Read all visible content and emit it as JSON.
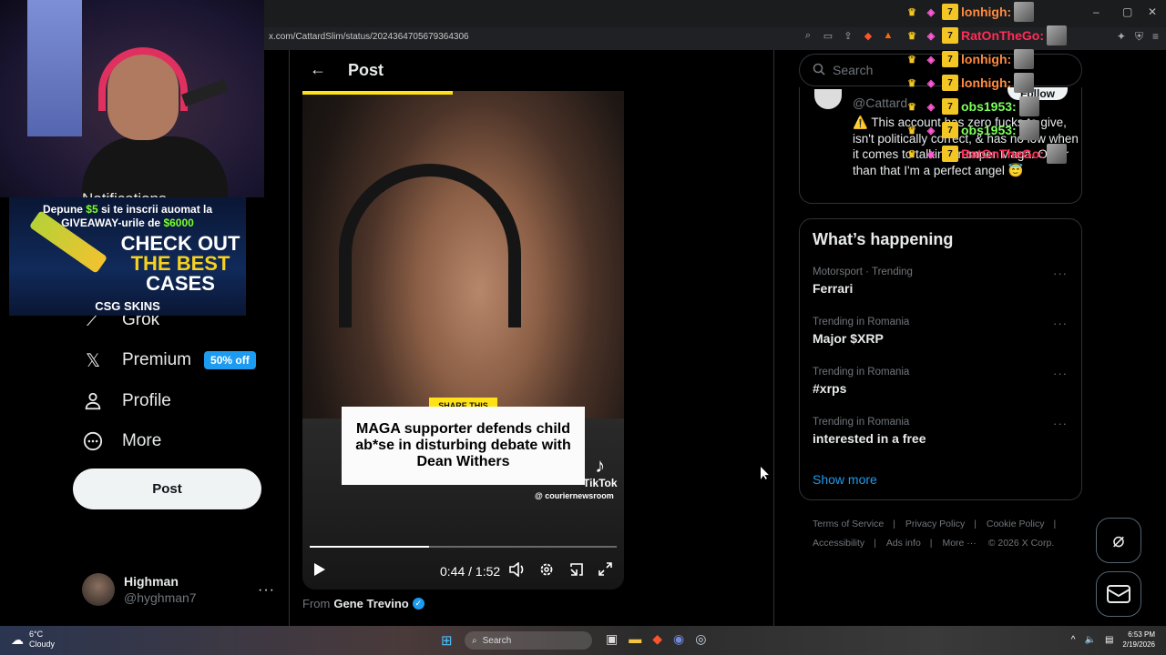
{
  "browser": {
    "url": "x.com/CattardSlim/status/2024364705679364306",
    "window_controls": [
      "–",
      "▢",
      "✕"
    ]
  },
  "nav": {
    "hidden_item": "Notifications",
    "items": [
      {
        "label": "Grok",
        "icon": "grok-icon"
      },
      {
        "label": "Premium",
        "icon": "x-logo-icon",
        "badge": "50% off"
      },
      {
        "label": "Profile",
        "icon": "profile-icon"
      },
      {
        "label": "More",
        "icon": "more-circle-icon"
      }
    ],
    "post_button": "Post",
    "account": {
      "name": "Highman",
      "handle": "@hyghman7",
      "more": "···"
    }
  },
  "header": {
    "back": "←",
    "title": "Post"
  },
  "video": {
    "share_tag": "SHARE THIS",
    "caption": "MAGA supporter defends child ab*se in disturbing debate with  Dean Withers",
    "tiktok": "TikTok",
    "watermark": "@ couriernewsroom",
    "time": "0:44 / 1:52",
    "progress": 0.39
  },
  "from": {
    "label": "From",
    "name": "Gene Trevino"
  },
  "search": {
    "placeholder": "Search"
  },
  "profile_card": {
    "handle": "@Cattard",
    "follow": "Follow",
    "bio": "⚠️ This account has zero fucks to give, isn't politically correct, & has no low when it comes to talking trumper Maga. Other than that I'm a perfect angel 😇"
  },
  "trends": {
    "title": "What’s happening",
    "items": [
      {
        "meta": "Motorsport · Trending",
        "name": "Ferrari"
      },
      {
        "meta": "Trending in Romania",
        "name": "Major $XRP"
      },
      {
        "meta": "Trending in Romania",
        "name": "#xrps"
      },
      {
        "meta": "Trending in Romania",
        "name": "interested in a free"
      }
    ],
    "more_glyph": "···",
    "show_more": "Show more"
  },
  "footer": {
    "links": [
      "Terms of Service",
      "Privacy Policy",
      "Cookie Policy",
      "Accessibility",
      "Ads info",
      "More ···",
      "© 2026 X Corp."
    ]
  },
  "chat": [
    {
      "user": "lonhigh:",
      "color": "#ff8a3d"
    },
    {
      "user": "RatOnTheGo:",
      "color": "#ff2d55"
    },
    {
      "user": "lonhigh:",
      "color": "#ff8a3d"
    },
    {
      "user": "lonhigh:",
      "color": "#ff8a3d"
    },
    {
      "user": "obs1953:",
      "color": "#7cff5a"
    },
    {
      "user": "obs1953:",
      "color": "#7cff5a"
    },
    {
      "user": "RatOnTheGo:",
      "color": "#ff2d55"
    }
  ],
  "ad": {
    "line1_a": "Depune",
    "line1_amount": "$5",
    "line1_b": "si te inscrii auomat la",
    "line2_a": "GIVEAWAY-urile de",
    "line2_amount": "$6000",
    "big1": "CHECK OUT",
    "big2": "THE BEST",
    "big3": "CASES",
    "logo": "CSG SKINS"
  },
  "taskbar": {
    "temp": "6°C",
    "condition": "Cloudy",
    "search": "Search",
    "time": "6:53 PM",
    "date": "2/19/2026"
  },
  "colors": {
    "accent": "#1d9bf0",
    "bg": "#000000",
    "border": "#2f3336",
    "yellow": "#ffe216"
  }
}
